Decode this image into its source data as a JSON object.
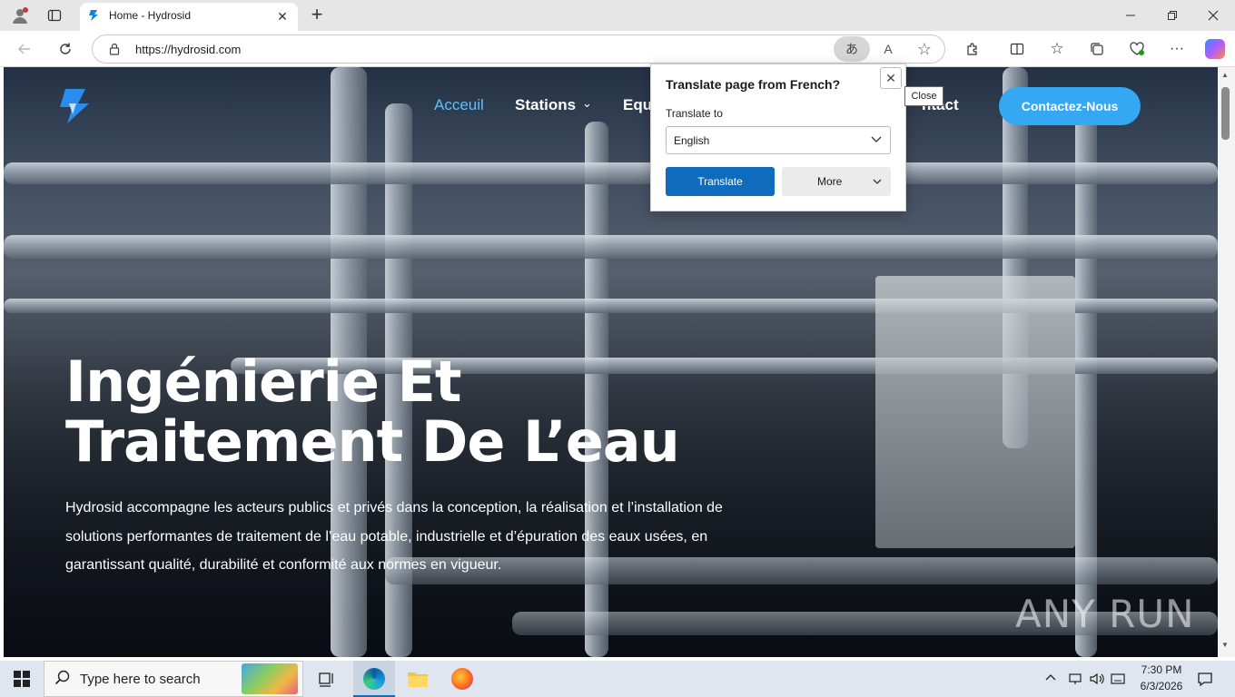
{
  "browser": {
    "tab_title": "Home - Hydrosid",
    "url": "https://hydrosid.com",
    "new_tab_symbol": "+"
  },
  "site": {
    "nav": {
      "home": "Acceuil",
      "stations": "Stations",
      "equipment_partial": "Equ",
      "contact_partial": "ntact",
      "cta": "Contactez-Nous"
    },
    "hero": {
      "title_line1": "Ingénierie Et",
      "title_line2": "Traitement De L’eau",
      "description": "Hydrosid accompagne les acteurs publics et privés dans la conception, la réalisation et l’installation de solutions performantes de traitement de l’eau potable, industrielle et d’épuration des eaux usées, en garantissant qualité, durabilité et conformité aux normes en vigueur."
    }
  },
  "translate_popup": {
    "title": "Translate page from French?",
    "translate_to_label": "Translate to",
    "selected_language": "English",
    "translate_button": "Translate",
    "more_button": "More",
    "close_tooltip": "Close"
  },
  "taskbar": {
    "search_placeholder": "Type here to search",
    "time": "7:30 PM",
    "date": "6/3/2026"
  },
  "watermark": "ANY RUN",
  "colors": {
    "accent_blue": "#0f6cbd",
    "cta_blue": "#34a8f3",
    "nav_active": "#5bc2ff"
  }
}
